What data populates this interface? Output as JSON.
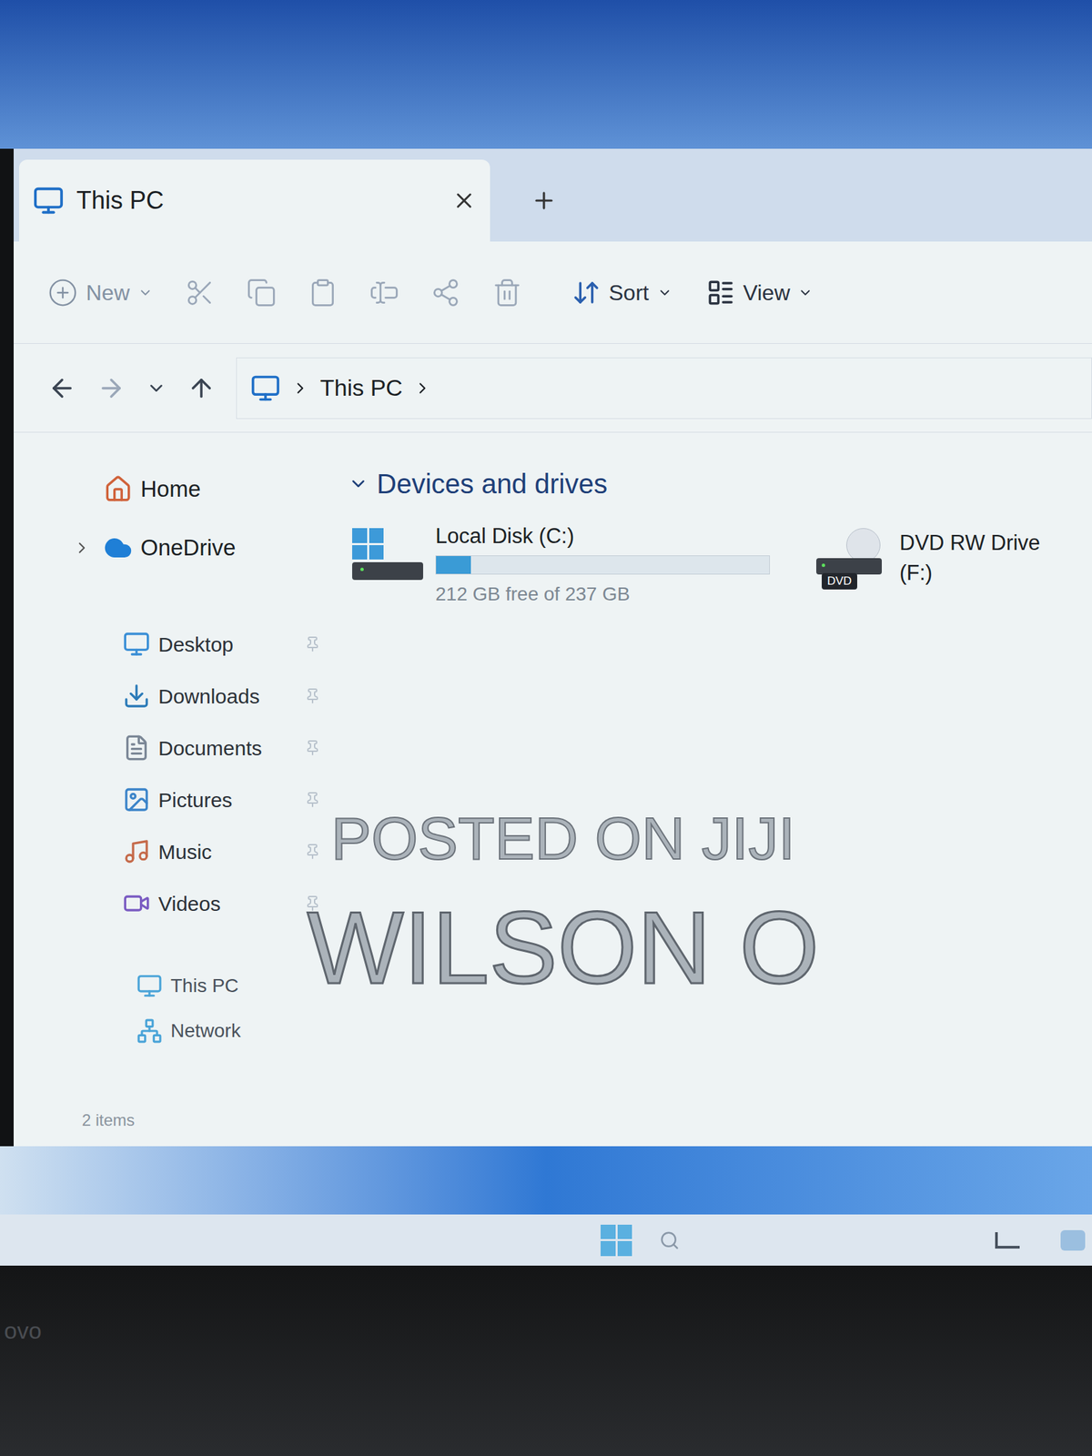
{
  "window": {
    "title": "This PC"
  },
  "toolbar": {
    "new": "New",
    "sort": "Sort",
    "view": "View"
  },
  "address_bar": {
    "breadcrumb": [
      "This PC"
    ]
  },
  "sidebar": {
    "top": [
      {
        "label": "Home",
        "expandable": false
      },
      {
        "label": "OneDrive",
        "expandable": true,
        "expanded": false
      }
    ],
    "pinned": [
      {
        "label": "Desktop",
        "pinned": true
      },
      {
        "label": "Downloads",
        "pinned": true
      },
      {
        "label": "Documents",
        "pinned": true
      },
      {
        "label": "Pictures",
        "pinned": true
      },
      {
        "label": "Music",
        "pinned": true
      },
      {
        "label": "Videos",
        "pinned": true
      }
    ],
    "bottom": [
      {
        "label": "This PC"
      },
      {
        "label": "Network"
      }
    ]
  },
  "section": {
    "title": "Devices and drives",
    "expanded": true
  },
  "drives": [
    {
      "kind": "disk",
      "name": "Local Disk (C:)",
      "level": 0.105,
      "free": "212 GB free of 237 GB"
    },
    {
      "kind": "dvd",
      "name": "DVD RW Drive (F:)",
      "badge": "DVD"
    }
  ],
  "status_bar": "2 items",
  "watermark": [
    "POSTED ON JIJI",
    "WILSON O"
  ],
  "bezel_logo": "ovo"
}
